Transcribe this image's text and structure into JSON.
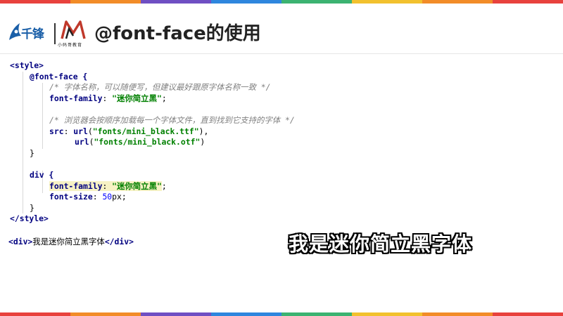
{
  "colors": {
    "rainbow": [
      "#e8423d",
      "#f28c28",
      "#6f4fc3",
      "#2e86de",
      "#3cb371",
      "#f2c12e",
      "#f28c28",
      "#e8423d"
    ],
    "brand_blue": "#1a5fa8",
    "brand_red": "#c0392b"
  },
  "header": {
    "logo_main": "千锋",
    "logo_sub": "小码哥教育",
    "title": "@font-face的使用"
  },
  "code": {
    "style_open": "<style>",
    "fontface_open": "@font-face {",
    "comment1": "/* 字体名称，可以随便写，但建议最好跟原字体名称一致 */",
    "prop_family": "font-family",
    "colon_sp": ": ",
    "family_value": "\"迷你简立黑\"",
    "semicolon": ";",
    "comment2": "/* 浏览器会按顺序加载每一个字体文件，直到找到它支持的字体 */",
    "prop_src": "src",
    "url_fn": "url",
    "paren_open": "(",
    "url1": "\"fonts/mini_black.ttf\"",
    "paren_close_comma": "),",
    "url2": "\"fonts/mini_black.otf\"",
    "paren_close": ")",
    "close_brace": "}",
    "div_open": "div {",
    "prop_size": "font-size",
    "size_value": "50",
    "size_unit": "px",
    "style_close": "</style>"
  },
  "div_example": {
    "open_tag": "<div>",
    "text": "我是迷你简立黑字体",
    "close_tag": "</div>"
  },
  "demo_text": "我是迷你简立黑字体"
}
